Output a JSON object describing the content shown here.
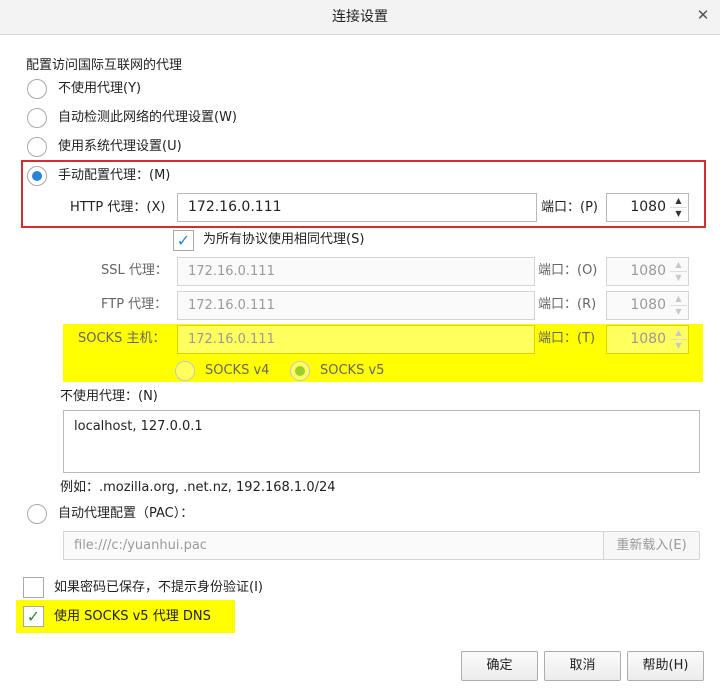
{
  "window": {
    "title": "连接设置",
    "close_glyph": "✕"
  },
  "section_title": "配置访问国际互联网的代理",
  "proxy_modes": {
    "none": "不使用代理(Y)",
    "auto_detect": "自动检测此网络的代理设置(W)",
    "system": "使用系统代理设置(U)",
    "manual": "手动配置代理：(M)"
  },
  "http": {
    "label": "HTTP 代理：(X)",
    "value": "172.16.0.111",
    "port_label": "端口：(P)",
    "port": "1080"
  },
  "same_proxy": "为所有协议使用相同代理(S)",
  "ssl": {
    "label": "SSL 代理：",
    "value": "172.16.0.111",
    "port_label": "端口：(O)",
    "port": "1080"
  },
  "ftp": {
    "label": "FTP 代理：",
    "value": "172.16.0.111",
    "port_label": "端口：(R)",
    "port": "1080"
  },
  "socks": {
    "label": "SOCKS 主机：",
    "value": "172.16.0.111",
    "port_label": "端口：(T)",
    "port": "1080",
    "v4": "SOCKS v4",
    "v5": "SOCKS v5"
  },
  "no_proxy": {
    "label": "不使用代理：(N)",
    "value": "localhost, 127.0.0.1",
    "example": "例如：.mozilla.org, .net.nz, 192.168.1.0/24"
  },
  "pac": {
    "label": "自动代理配置（PAC）：",
    "value": "file:///c:/yuanhui.pac",
    "reload": "重新载入(E)"
  },
  "no_auth_prompt": "如果密码已保存，不提示身份验证(I)",
  "socks_dns": "使用 SOCKS v5 代理 DNS",
  "buttons": {
    "ok": "确定",
    "cancel": "取消",
    "help": "帮助(H)"
  },
  "colors": {
    "accent": "#2a84d6",
    "highlight": "#ffff00",
    "annotation": "#d72c2c"
  }
}
